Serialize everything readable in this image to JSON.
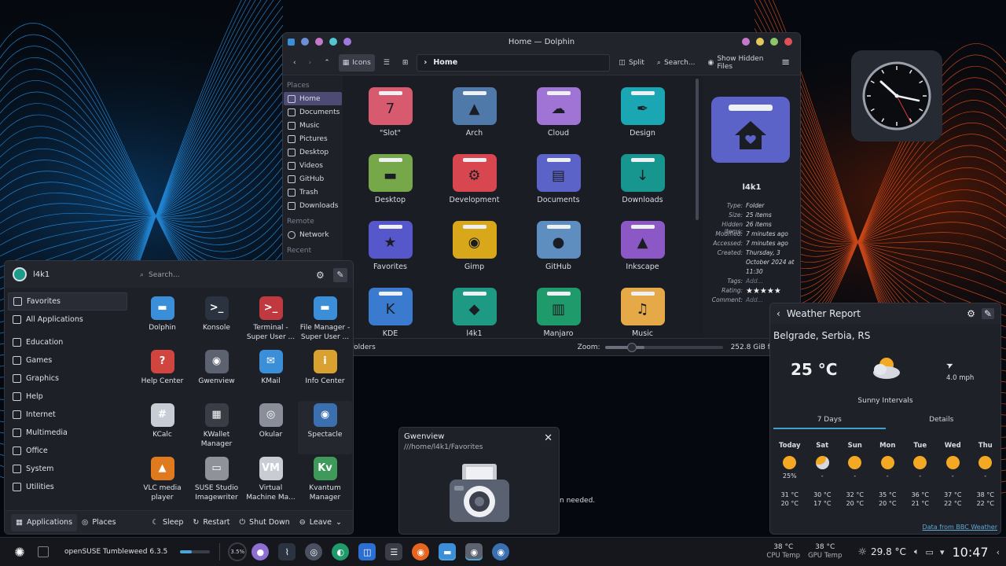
{
  "dolphin": {
    "title": "Home — Dolphin",
    "toolbar": {
      "view_icons": "Icons",
      "split": "Split",
      "search": "Search...",
      "hidden": "Show Hidden Files",
      "crumb": "Home"
    },
    "places_head": "Places",
    "places": [
      "Home",
      "Documents",
      "Music",
      "Pictures",
      "Desktop",
      "Videos",
      "GitHub",
      "Trash",
      "Downloads"
    ],
    "remote_head": "Remote",
    "remote": [
      "Network"
    ],
    "recent_head": "Recent",
    "folders": [
      {
        "name": "\"Slot\"",
        "color": "#d85a6f",
        "glyph": "7"
      },
      {
        "name": "Arch",
        "color": "#4f79a8",
        "glyph": "▲"
      },
      {
        "name": "Cloud",
        "color": "#9f74d4",
        "glyph": "☁"
      },
      {
        "name": "Design",
        "color": "#1aa6b3",
        "glyph": "✒"
      },
      {
        "name": "Desktop",
        "color": "#76a84a",
        "glyph": "▬"
      },
      {
        "name": "Development",
        "color": "#d8474f",
        "glyph": "⚙"
      },
      {
        "name": "Documents",
        "color": "#5b63c8",
        "glyph": "▤"
      },
      {
        "name": "Downloads",
        "color": "#17958f",
        "glyph": "↓"
      },
      {
        "name": "Favorites",
        "color": "#5757cc",
        "glyph": "★"
      },
      {
        "name": "Gimp",
        "color": "#d9a81a",
        "glyph": "◉"
      },
      {
        "name": "GitHub",
        "color": "#5e8dbf",
        "glyph": "●"
      },
      {
        "name": "Inkscape",
        "color": "#8b58c5",
        "glyph": "▲"
      },
      {
        "name": "KDE",
        "color": "#3a7bcf",
        "glyph": "K"
      },
      {
        "name": "l4k1",
        "color": "#1e9a84",
        "glyph": "◆"
      },
      {
        "name": "Manjaro",
        "color": "#1f9a6a",
        "glyph": "▥"
      },
      {
        "name": "Music",
        "color": "#e6a948",
        "glyph": "♫"
      }
    ],
    "info": {
      "name": "l4k1",
      "rows": [
        {
          "k": "Type:",
          "v": "Folder"
        },
        {
          "k": "Size:",
          "v": "25 items"
        },
        {
          "k": "Hidden items:",
          "v": "26 items"
        },
        {
          "k": "Modified:",
          "v": "7 minutes ago"
        },
        {
          "k": "Accessed:",
          "v": "7 minutes ago"
        },
        {
          "k": "Created:",
          "v": "Thursday, 3"
        },
        {
          "k": "",
          "v": "October 2024 at"
        },
        {
          "k": "",
          "v": "11:30"
        },
        {
          "k": "Tags:",
          "v": "Add..."
        },
        {
          "k": "Rating:",
          "v": "★★★★★"
        },
        {
          "k": "Comment:",
          "v": "Add..."
        }
      ]
    },
    "status": {
      "left": "folders",
      "zoom": "Zoom:",
      "free": "252.8 GiB free"
    }
  },
  "launcher": {
    "user": "l4k1",
    "search_placeholder": "Search...",
    "categories": [
      "Favorites",
      "All Applications",
      "Education",
      "Games",
      "Graphics",
      "Help",
      "Internet",
      "Multimedia",
      "Office",
      "System",
      "Utilities"
    ],
    "apps": [
      {
        "name": "Dolphin",
        "color": "#3b8fd9",
        "glyph": "▬"
      },
      {
        "name": "Konsole",
        "color": "#2c3340",
        "glyph": ">_"
      },
      {
        "name": "Terminal - Super User ...",
        "color": "#c0393f",
        "glyph": ">_"
      },
      {
        "name": "File Manager - Super User ...",
        "color": "#3b8fd9",
        "glyph": "▬"
      },
      {
        "name": "Help Center",
        "color": "#d0453f",
        "glyph": "?"
      },
      {
        "name": "Gwenview",
        "color": "#5c6270",
        "glyph": "◉"
      },
      {
        "name": "KMail",
        "color": "#3b8fd9",
        "glyph": "✉"
      },
      {
        "name": "Info Center",
        "color": "#d9a230",
        "glyph": "i"
      },
      {
        "name": "KCalc",
        "color": "#c8ccd4",
        "glyph": "#"
      },
      {
        "name": "KWallet Manager",
        "color": "#3a3d46",
        "glyph": "▦"
      },
      {
        "name": "Okular",
        "color": "#8a8e98",
        "glyph": "◎"
      },
      {
        "name": "Spectacle",
        "color": "#3a6fb0",
        "glyph": "◉"
      },
      {
        "name": "VLC media player",
        "color": "#e07a1f",
        "glyph": "▲"
      },
      {
        "name": "SUSE Studio Imagewriter",
        "color": "#8f9399",
        "glyph": "▭"
      },
      {
        "name": "Virtual Machine Ma...",
        "color": "#c9cdd3",
        "glyph": "VM"
      },
      {
        "name": "Kvantum Manager",
        "color": "#3d9a5a",
        "glyph": "Kv"
      }
    ],
    "footer": {
      "apps": "Applications",
      "places": "Places",
      "sleep": "Sleep",
      "restart": "Restart",
      "shutdown": "Shut Down",
      "leave": "Leave"
    }
  },
  "tooltip": {
    "title": "Gwenview",
    "subtitle": "///home/l4k1/Favorites"
  },
  "behind_text": "n needed.",
  "weather": {
    "title": "Weather Report",
    "location": "Belgrade, Serbia, RS",
    "temp": "25 °C",
    "wind": "4.0 mph",
    "condition": "Sunny Intervals",
    "tabs": [
      "7 Days",
      "Details"
    ],
    "days": [
      {
        "d": "Today",
        "extra": "25%",
        "hi": "31 °C",
        "lo": "20 °C"
      },
      {
        "d": "Sat",
        "extra": "-",
        "hi": "30 °C",
        "lo": "17 °C"
      },
      {
        "d": "Sun",
        "extra": "-",
        "hi": "32 °C",
        "lo": "20 °C"
      },
      {
        "d": "Mon",
        "extra": "-",
        "hi": "35 °C",
        "lo": "20 °C"
      },
      {
        "d": "Tue",
        "extra": "-",
        "hi": "36 °C",
        "lo": "21 °C"
      },
      {
        "d": "Wed",
        "extra": "-",
        "hi": "37 °C",
        "lo": "22 °C"
      },
      {
        "d": "Thu",
        "extra": "-",
        "hi": "38 °C",
        "lo": "22 °C"
      }
    ],
    "source": "Data from BBC Weather"
  },
  "taskbar": {
    "os": "openSUSE Tumbleweed 6.3.5",
    "cpu_load": "3.5%",
    "cpu_temp": "38 °C",
    "cpu_label": "CPU Temp",
    "gpu_temp": "38 °C",
    "gpu_label": "GPU Temp",
    "weather_temp": "29.8 °C",
    "time": "10:47"
  }
}
